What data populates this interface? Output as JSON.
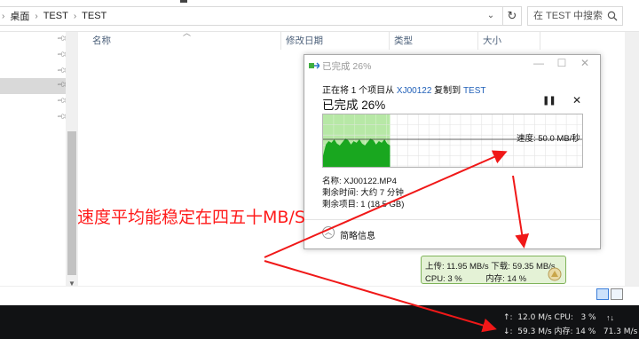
{
  "explorer": {
    "breadcrumb": [
      "桌面",
      "TEST",
      "TEST"
    ],
    "search_placeholder": "在 TEST 中搜索",
    "columns": [
      "名称",
      "修改日期",
      "类型",
      "大小"
    ]
  },
  "copy_dialog": {
    "title": "已完成 26%",
    "line_prefix": "正在将 1 个项目从",
    "source": "XJ00122",
    "line_mid": "复制到",
    "dest": "TEST",
    "percent_label": "已完成 26%",
    "progress": 0.26,
    "speed_label": "速度: 50.0 MB/秒",
    "name_line": "名称: XJ00122.MP4",
    "time_line": "剩余时间: 大约 7 分钟",
    "items_line": "剩余项目: 1 (18.5 GB)",
    "less_details": "简略信息"
  },
  "speed_meter": {
    "line1": "上传: 11.95 MB/s 下载: 59.35 MB/s",
    "line2": "CPU: 3 %          内存: 14 %"
  },
  "taskbar": {
    "line1": "↑:  12.0 M/s CPU:   3 %",
    "line2": "↓:  59.3 M/s 内存: 14 %   71.3 M/s",
    "arrows": "↑↓"
  },
  "annotation": "速度平均能稳定在四五十MB/S",
  "colors": {
    "graph_fill": "#19a71f",
    "graph_bg": "#b7e8a6",
    "annotation": "#ff1a1a",
    "link": "#1f5fb8"
  }
}
